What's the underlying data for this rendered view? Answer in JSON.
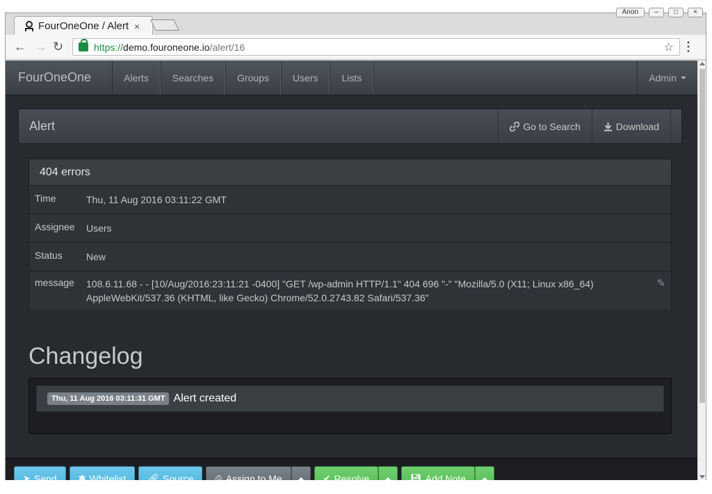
{
  "browser": {
    "tab_title": "FourOneOne / Alert",
    "tab_close": "×",
    "user_button": "Anon",
    "url_scheme": "https://",
    "url_host": "demo.fouroneone.io",
    "url_path": "/alert/16"
  },
  "navbar": {
    "brand": "FourOneOne",
    "items": [
      "Alerts",
      "Searches",
      "Groups",
      "Users",
      "Lists"
    ],
    "admin": "Admin"
  },
  "alert_header": {
    "title": "Alert",
    "go_to_search": "Go to Search",
    "download": "Download"
  },
  "alert": {
    "name": "404 errors",
    "rows": [
      {
        "key": "Time",
        "value": "Thu, 11 Aug 2016 03:11:22 GMT"
      },
      {
        "key": "Assignee",
        "value": "Users"
      },
      {
        "key": "Status",
        "value": "New"
      },
      {
        "key": "message",
        "value": "108.6.11.68 - - [10/Aug/2016:23:11:21 -0400] \"GET /wp-admin HTTP/1.1\" 404 696 \"-\" \"Mozilla/5.0 (X11; Linux x86_64) AppleWebKit/537.36 (KHTML, like Gecko) Chrome/52.0.2743.82 Safari/537.36\""
      }
    ]
  },
  "changelog": {
    "title": "Changelog",
    "entries": [
      {
        "timestamp": "Thu, 11 Aug 2016 03:11:31 GMT",
        "text": "Alert created"
      }
    ]
  },
  "actions": {
    "send": "Send",
    "whitelist": "Whitelist",
    "source": "Source",
    "assign_to_me": "Assign to Me",
    "resolve": "Resolve",
    "add_note": "Add Note"
  },
  "colors": {
    "page_bg": "#272b30",
    "info": "#5bc0de",
    "success": "#62c462",
    "default": "#6c757d"
  }
}
